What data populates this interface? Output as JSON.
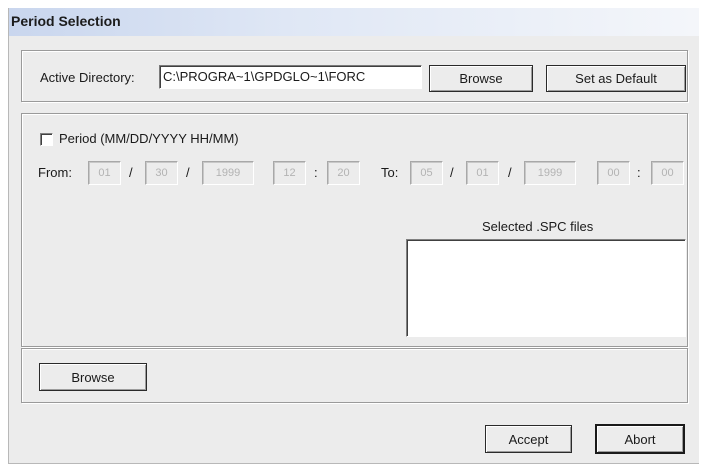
{
  "window": {
    "title": "Period Selection"
  },
  "directory": {
    "label": "Active Directory:",
    "value": "C:\\PROGRA~1\\GPDGLO~1\\FORC",
    "browse_label": "Browse",
    "set_default_label": "Set as Default"
  },
  "period": {
    "checkbox_label": "Period (MM/DD/YYYY HH/MM)",
    "checked": false,
    "from_label": "From:",
    "to_label": "To:",
    "date_sep": "/",
    "time_sep": ":",
    "from": {
      "month": "01",
      "day": "30",
      "year": "1999",
      "hour": "12",
      "minute": "20"
    },
    "to": {
      "month": "05",
      "day": "01",
      "year": "1999",
      "hour": "00",
      "minute": "00"
    }
  },
  "files": {
    "label": "Selected .SPC files",
    "items": []
  },
  "bottom_group": {
    "browse_label": "Browse"
  },
  "actions": {
    "accept_label": "Accept",
    "abort_label": "Abort"
  }
}
